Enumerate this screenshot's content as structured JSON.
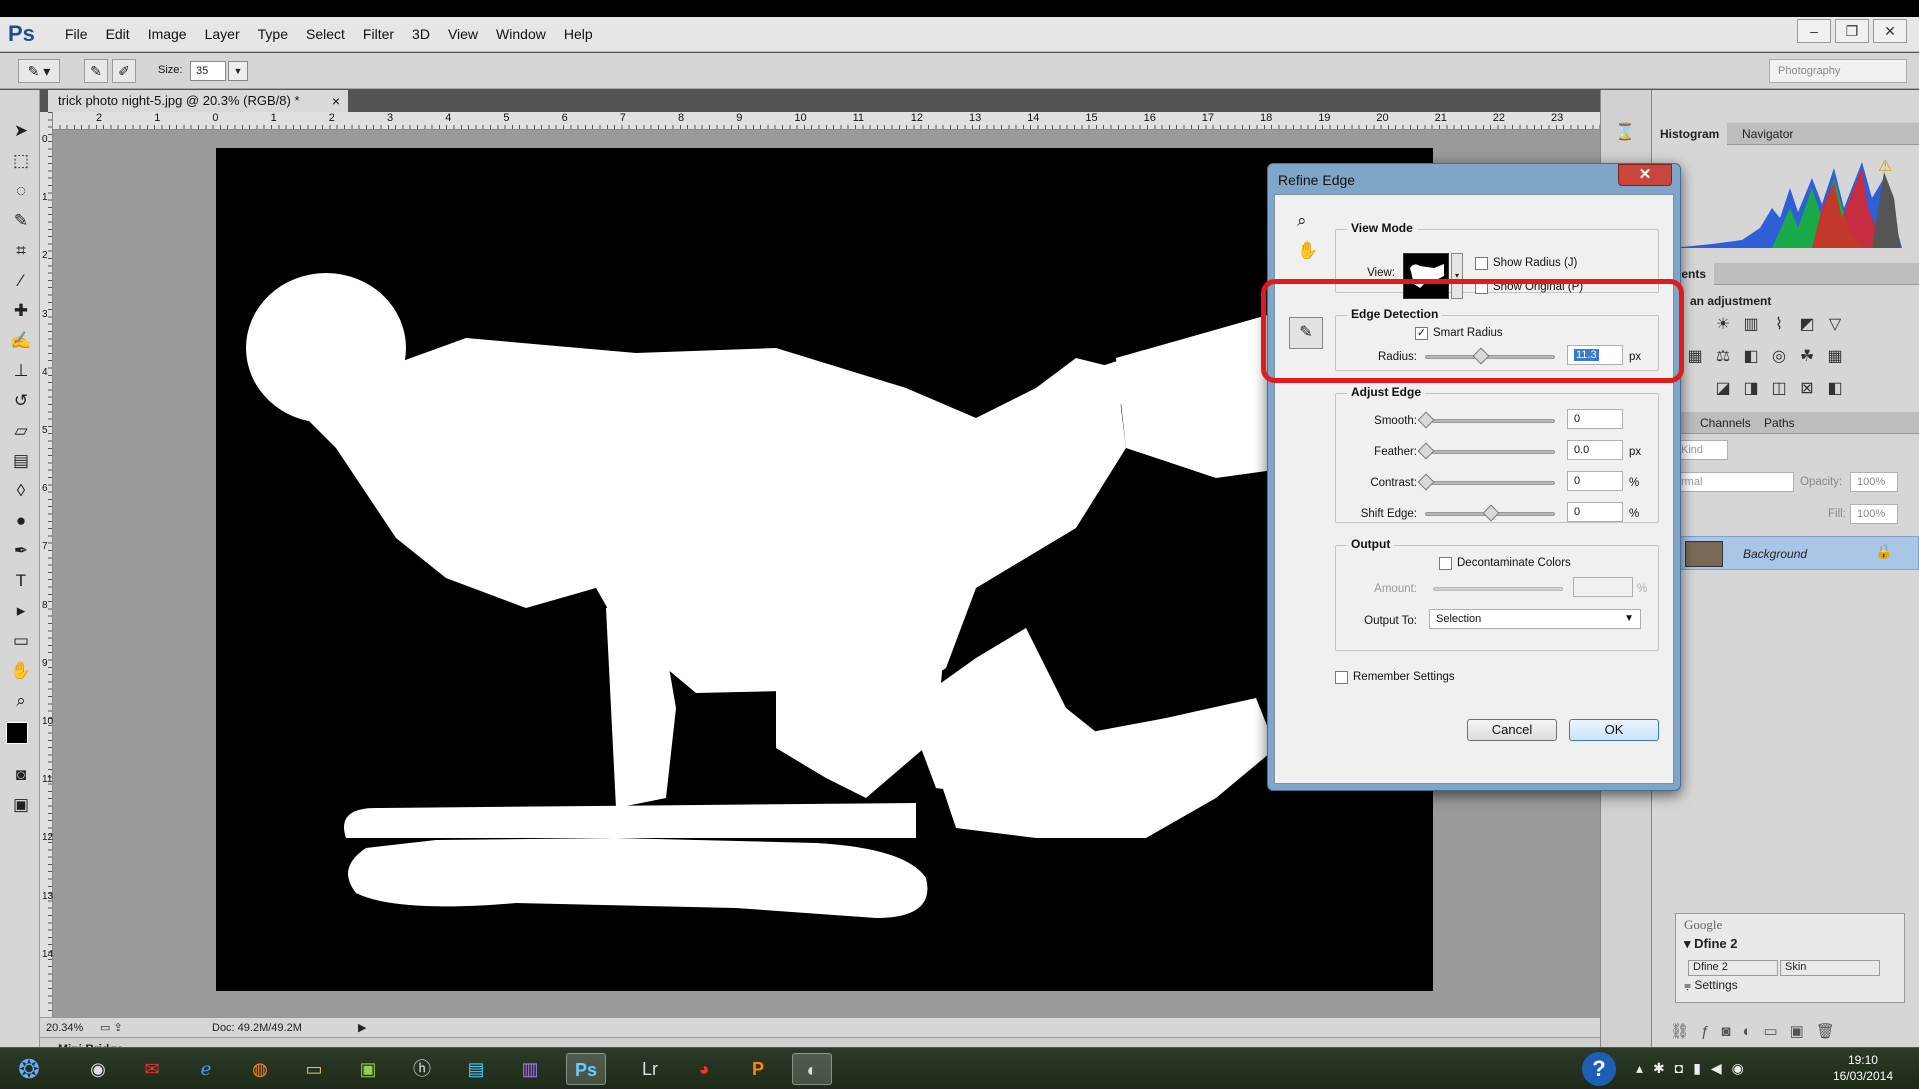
{
  "app": {
    "logo": "Ps",
    "menus": [
      "File",
      "Edit",
      "Image",
      "Layer",
      "Type",
      "Select",
      "Filter",
      "3D",
      "View",
      "Window",
      "Help"
    ],
    "window_buttons": [
      "–",
      "❐",
      "✕"
    ]
  },
  "options_bar": {
    "size_label": "Size:",
    "size_value": "35",
    "workspace": "Photography"
  },
  "document": {
    "tab_title": "trick photo night-5.jpg @ 20.3% (RGB/8) *",
    "close": "×",
    "ruler_h": [
      "2",
      "1",
      "0",
      "1",
      "2",
      "3",
      "4",
      "5",
      "6",
      "7",
      "8",
      "9",
      "10",
      "11",
      "12",
      "13",
      "14",
      "15",
      "16",
      "17",
      "18",
      "19",
      "20",
      "21",
      "22",
      "23"
    ],
    "ruler_v": [
      "0",
      "1",
      "2",
      "3",
      "4",
      "5",
      "6",
      "7",
      "8",
      "9",
      "10",
      "11",
      "12",
      "13",
      "14"
    ],
    "zoom": "20.34%",
    "doc_info": "Doc: 49.2M/49.2M"
  },
  "mini_bridge": "Mini Bridge",
  "panels": {
    "top_tabs": [
      "Histogram",
      "Navigator"
    ],
    "adjust_tab": "stments",
    "adjust_prompt": "an adjustment",
    "layer_tabs": [
      "rs",
      "Channels",
      "Paths"
    ],
    "kind": "Kind",
    "blend": "rmal",
    "opacity_label": "Opacity:",
    "opacity": "100%",
    "fill_label": "Fill:",
    "fill": "100%",
    "layer_name": "Background",
    "google_title": "Google",
    "google_item": "Dfine 2",
    "google_sub1": "Dfine 2",
    "google_sub2": "Skin",
    "google_settings": "Settings"
  },
  "dialog": {
    "title": "Refine Edge",
    "close": "✕",
    "view_mode": {
      "title": "View Mode",
      "view_label": "View:",
      "show_radius": "Show Radius (J)",
      "show_original": "Show Original (P)"
    },
    "edge_detection": {
      "title": "Edge Detection",
      "smart_radius": "Smart Radius",
      "smart_radius_checked": true,
      "radius_label": "Radius:",
      "radius_value": "11.3",
      "radius_unit": "px",
      "radius_pos": 0.42
    },
    "adjust_edge": {
      "title": "Adjust Edge",
      "rows": [
        {
          "label": "Smooth:",
          "value": "0",
          "unit": "",
          "pos": 0.0
        },
        {
          "label": "Feather:",
          "value": "0.0",
          "unit": "px",
          "pos": 0.0
        },
        {
          "label": "Contrast:",
          "value": "0",
          "unit": "%",
          "pos": 0.0
        },
        {
          "label": "Shift Edge:",
          "value": "0",
          "unit": "%",
          "pos": 0.5
        }
      ]
    },
    "output": {
      "title": "Output",
      "decontaminate": "Decontaminate Colors",
      "amount_label": "Amount:",
      "amount_unit": "%",
      "output_to_label": "Output To:",
      "output_to": "Selection"
    },
    "remember": "Remember Settings",
    "cancel": "Cancel",
    "ok": "OK"
  },
  "taskbar": {
    "time": "19:10",
    "date": "16/03/2014"
  },
  "colors": {
    "highlight": "#e01b1b",
    "ps_blue": "#1f4e8c",
    "dialog_frame": "#7fa5c8"
  }
}
